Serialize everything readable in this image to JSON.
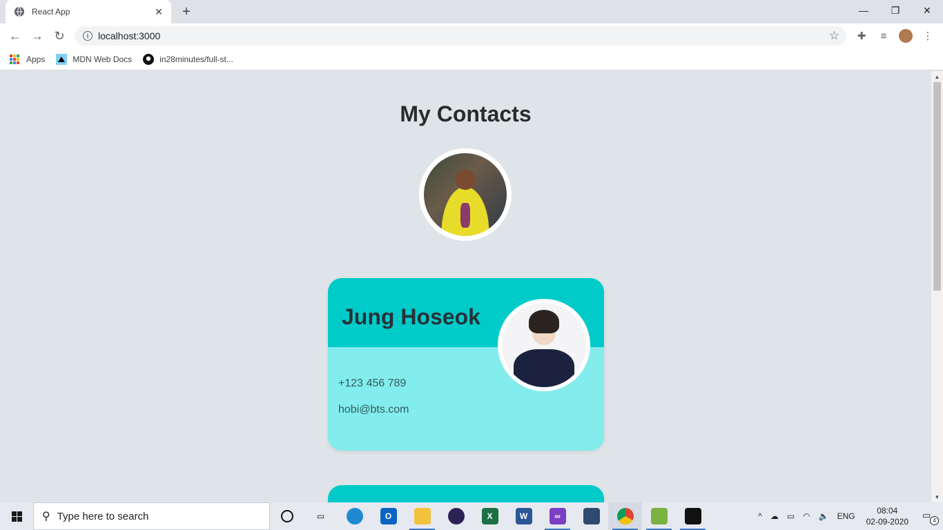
{
  "browser": {
    "tab_title": "React App",
    "url": "localhost:3000",
    "bookmarks": [
      {
        "label": "Apps"
      },
      {
        "label": "MDN Web Docs"
      },
      {
        "label": "in28minutes/full-st..."
      }
    ]
  },
  "page": {
    "heading": "My Contacts",
    "contacts": [
      {
        "name": "Jung Hoseok",
        "phone": "+123 456 789",
        "email": "hobi@bts.com"
      }
    ]
  },
  "colors": {
    "card_header": "#00cbc9",
    "card_body": "#83ecec",
    "page_bg": "#dfe4e8"
  },
  "taskbar": {
    "search_placeholder": "Type here to search",
    "language": "ENG",
    "time": "08:04",
    "date": "02-09-2020",
    "notification_count": "4"
  }
}
